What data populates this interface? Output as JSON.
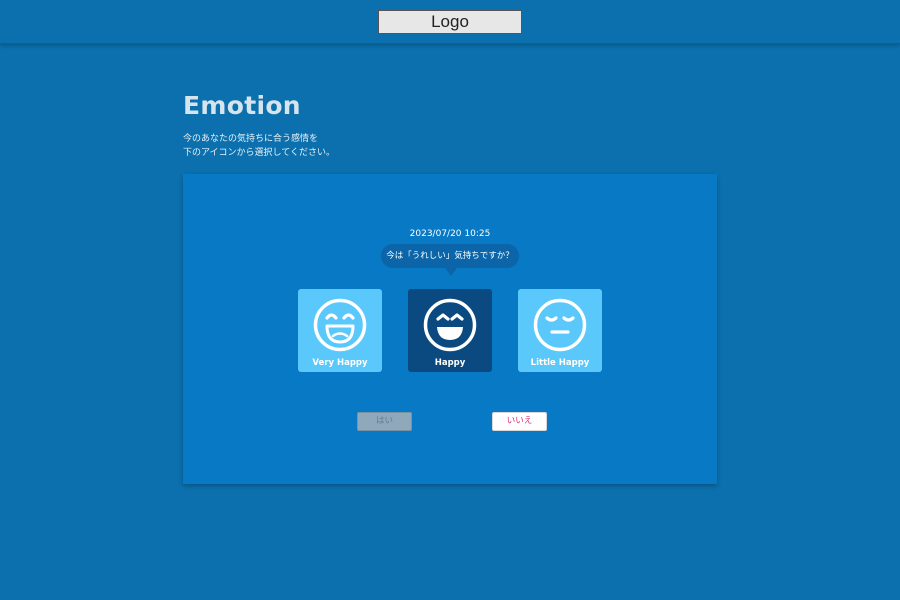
{
  "header": {
    "logo_text": "Logo"
  },
  "main": {
    "title": "Emotion",
    "description_lines": [
      "今のあなたの気持ちに合う感情を",
      "下のアイコンから選択してください。"
    ]
  },
  "card": {
    "datetime": "2023/07/20 10:25",
    "question": "今は「うれしい」気持ちですか？",
    "options": [
      {
        "label": "Very Happy",
        "icon": "very-happy-face-icon",
        "selected": false
      },
      {
        "label": "Happy",
        "icon": "happy-face-icon",
        "selected": true
      },
      {
        "label": "Little Happy",
        "icon": "little-happy-face-icon",
        "selected": false
      }
    ],
    "yes_label": "はい",
    "no_label": "いいえ"
  },
  "colors": {
    "background": "#0b70ad",
    "card": "#0779c5",
    "option": "#5ac8fa",
    "option_selected": "#0a4a80",
    "no_text": "#e0287a"
  }
}
